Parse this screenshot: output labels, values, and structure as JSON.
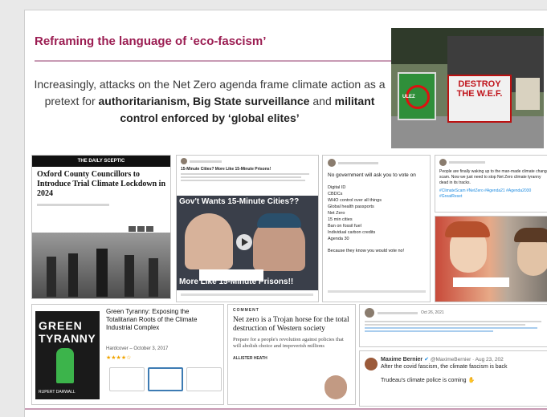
{
  "slide": {
    "title": "Reframing the language of ‘eco-fascism’",
    "intro_pre": "Increasingly, attacks on the Net Zero agenda frame climate action as a pretext for ",
    "intro_b1": "authoritarianism, Big State surveillance",
    "intro_mid": " and ",
    "intro_b2": "militant control enforced by ‘global elites’"
  },
  "photo": {
    "sign1": "ULEZ",
    "sign2": "DESTROY THE W.E.F."
  },
  "daily_sceptic": {
    "masthead": "THE DAILY SCEPTIC",
    "headline": "Oxford County Councillors to Introduce Trial Climate Lockdown in 2024"
  },
  "video_card": {
    "top_line": "15-Minute Cities? More Like 15-Minute Prisons!",
    "caption_top": "Gov't Wants 15-Minute Cities??",
    "caption_bottom": "More Like 15-Minute Prisons!!"
  },
  "list_tweet": {
    "intro": "No government will ask you to vote on",
    "items": [
      "Digital ID",
      "CBDCs",
      "WHO control over all things",
      "Global health passports",
      "Net Zero",
      "15 min cities",
      "Ban on fossil fuel",
      "Individual carbon credits",
      "Agenda 30"
    ],
    "outro": "Because they know you would vote no!"
  },
  "man_made_tweet": {
    "text": "People are finally waking up to the man-made climate change scam. Now we just need to stop Net Zero climate tyranny dead in its tracks.",
    "tags": "#ClimateScam #NetZero #Agenda21 #Agenda2030 #GreatReset"
  },
  "book": {
    "cover_line1": "GREEN",
    "cover_line2": "TYRANNY",
    "cover_author": "RUPERT DARWALL",
    "title": "Green Tyranny: Exposing the Totalitarian Roots of the Climate Industrial Complex",
    "format": "Hardcover –",
    "date": "October 3, 2017"
  },
  "comment": {
    "label": "COMMENT",
    "headline": "Net zero is a Trojan horse for the total destruction of Western society",
    "subhead": "Prepare for a people's revolution against policies that will abolish choice and impoverish millions",
    "author": "ALLISTER HEATH"
  },
  "tweet_small": {
    "date": "Oct 26, 2021"
  },
  "bernier": {
    "name": "Maxime Bernier",
    "handle": "@MaximeBernier · Aug 23, 202",
    "line1": "After the covid fascism, the climate fascism is back",
    "line2": "Trudeau's climate police is coming"
  }
}
